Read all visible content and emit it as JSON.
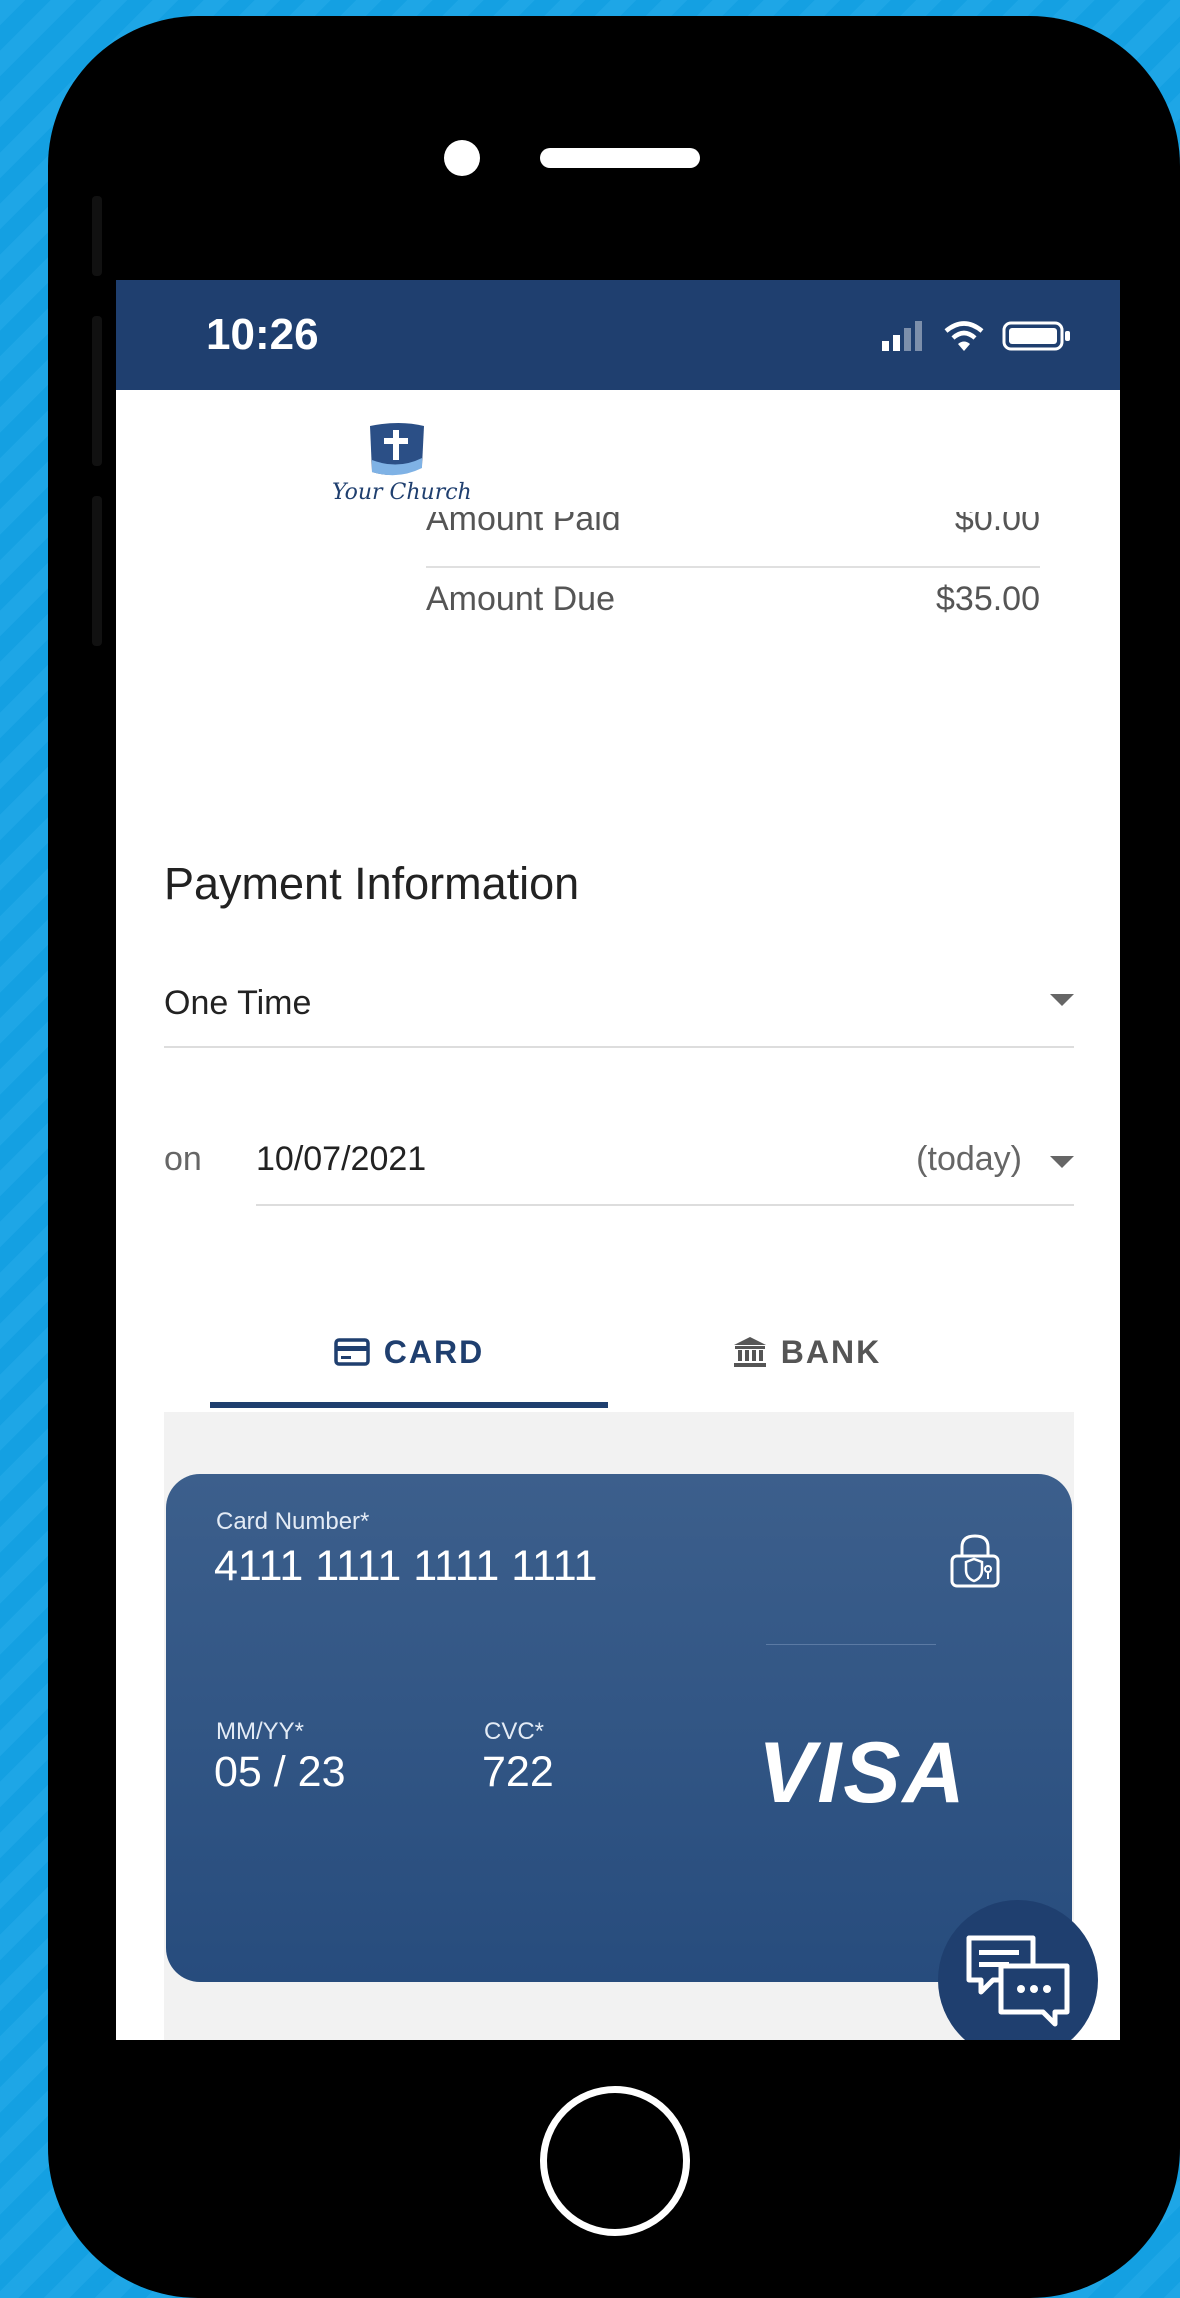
{
  "status_bar": {
    "time": "10:26"
  },
  "brand": {
    "logo_text": "Your Church"
  },
  "summary": {
    "paid_label": "Amount Paid",
    "paid_value": "$0.00",
    "due_label": "Amount Due",
    "due_value": "$35.00"
  },
  "payment": {
    "title": "Payment Information",
    "frequency": "One Time",
    "on_label": "on",
    "date": "10/07/2021",
    "date_note": "(today)"
  },
  "tabs": [
    {
      "label": "CARD",
      "icon": "credit-card-icon",
      "active": true
    },
    {
      "label": "BANK",
      "icon": "bank-icon",
      "active": false
    }
  ],
  "card": {
    "number_label": "Card Number*",
    "number": "4111 1111 1111 1111",
    "expiry_label": "MM/YY*",
    "expiry": "05 / 23",
    "cvc_label": "CVC*",
    "cvc": "722",
    "brand": "VISA"
  },
  "colors": {
    "primary": "#1f3f6f",
    "card": "#2e5283",
    "background": "#1ea6e6"
  }
}
